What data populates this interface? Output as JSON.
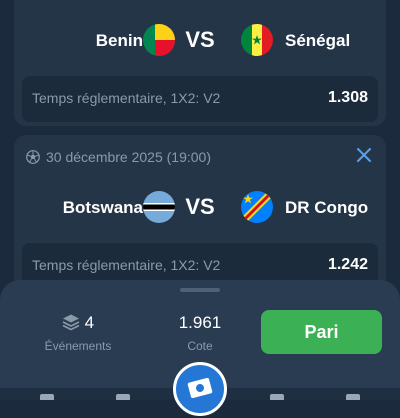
{
  "colors": {
    "background": "#1b2a3d",
    "card": "#243547",
    "bet_row": "#1c2b3c",
    "panel": "#2a3c52",
    "accent_green": "#3cb055",
    "muted_text": "#8b9aab",
    "close_blue": "#5aa0e6",
    "fab_blue": "#2477d4"
  },
  "matches": [
    {
      "home": {
        "name": "Benin",
        "flag_icon": "benin-flag-icon"
      },
      "vs": "VS",
      "away": {
        "name": "Sénégal",
        "flag_icon": "senegal-flag-icon"
      },
      "bet": {
        "label": "Temps réglementaire, 1X2: V2",
        "odd": "1.308"
      }
    },
    {
      "date": "30 décembre 2025 (19:00)",
      "sport_icon": "soccer-ball-icon",
      "close_icon": "close-icon",
      "home": {
        "name": "Botswana",
        "flag_icon": "botswana-flag-icon"
      },
      "vs": "VS",
      "away": {
        "name": "DR Congo",
        "flag_icon": "dr-congo-flag-icon"
      },
      "bet": {
        "label": "Temps réglementaire, 1X2: V2",
        "odd": "1.242"
      }
    }
  ],
  "summary": {
    "events_count": "4",
    "events_label": "Événements",
    "events_icon": "layers-icon",
    "odds_value": "1.961",
    "odds_label": "Cote",
    "button_label": "Pari"
  },
  "coupon_icon": "ticket-icon"
}
